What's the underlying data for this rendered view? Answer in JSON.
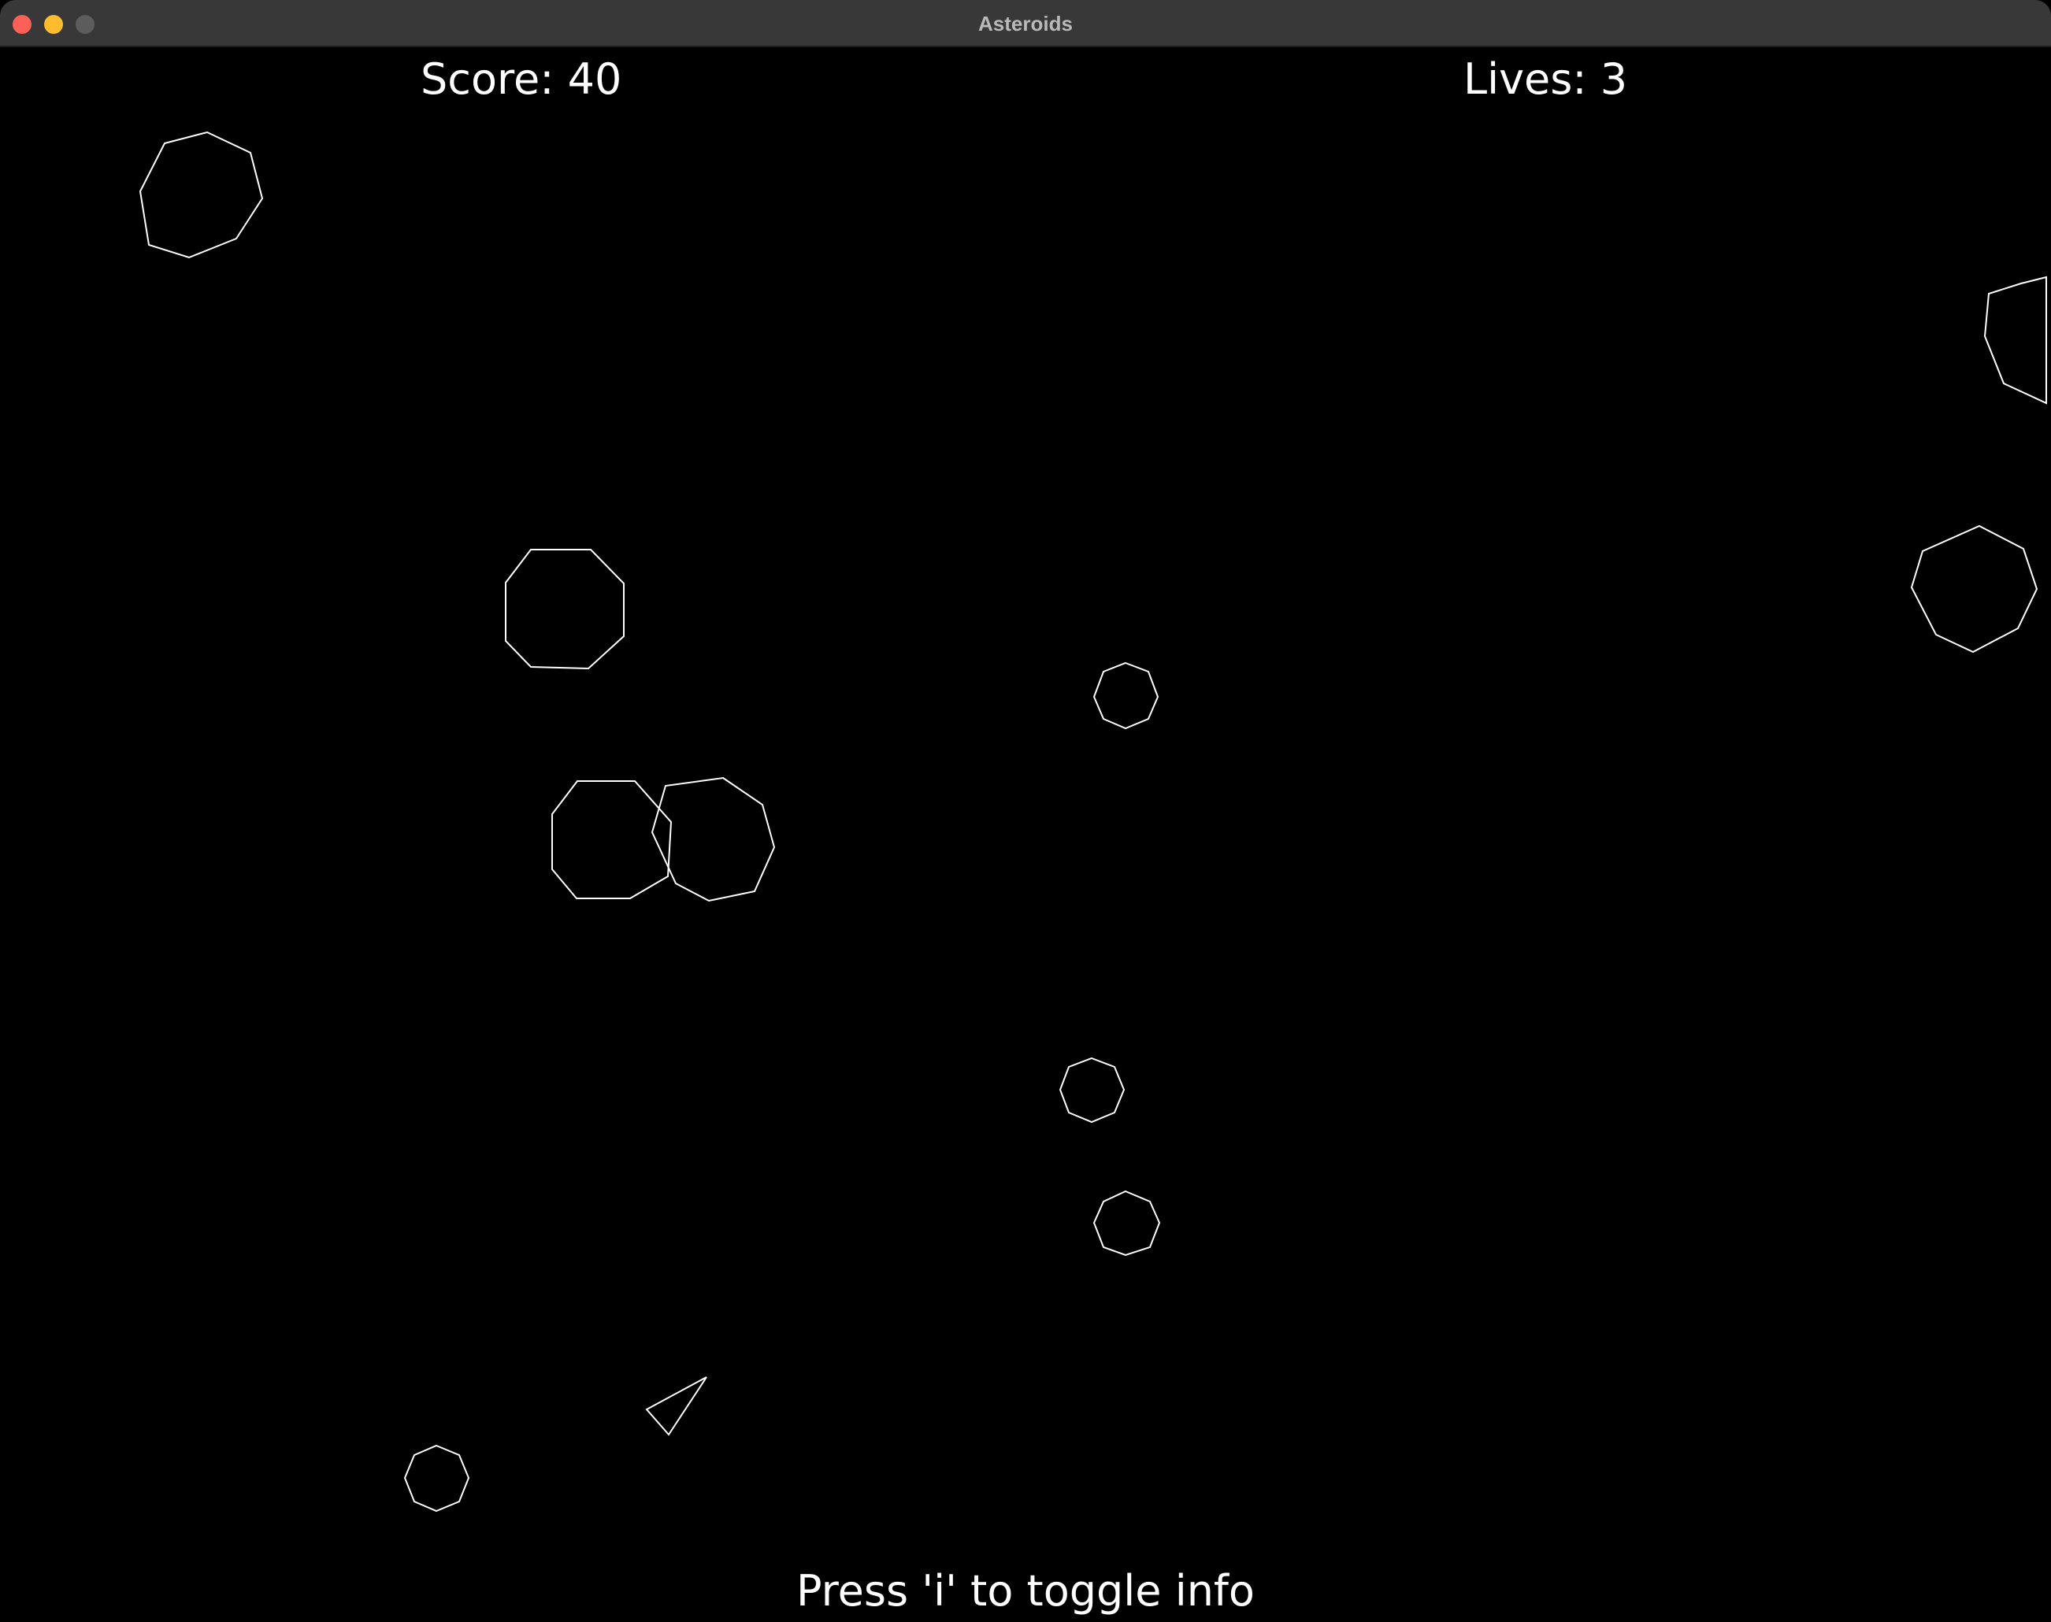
{
  "window": {
    "title": "Asteroids"
  },
  "hud": {
    "score_text": "Score: 40",
    "lives_text": "Lives: 3",
    "info_hint": "Press 'i' to toggle info"
  },
  "colors": {
    "background": "#000000",
    "foreground": "#ffffff",
    "titlebar": "#383838",
    "close": "#fe5f57",
    "minimize": "#febc2e",
    "zoom": "#5c5c5c"
  },
  "icons": {
    "close": "close-button",
    "minimize": "minimize-button",
    "zoom": "zoom-button"
  }
}
